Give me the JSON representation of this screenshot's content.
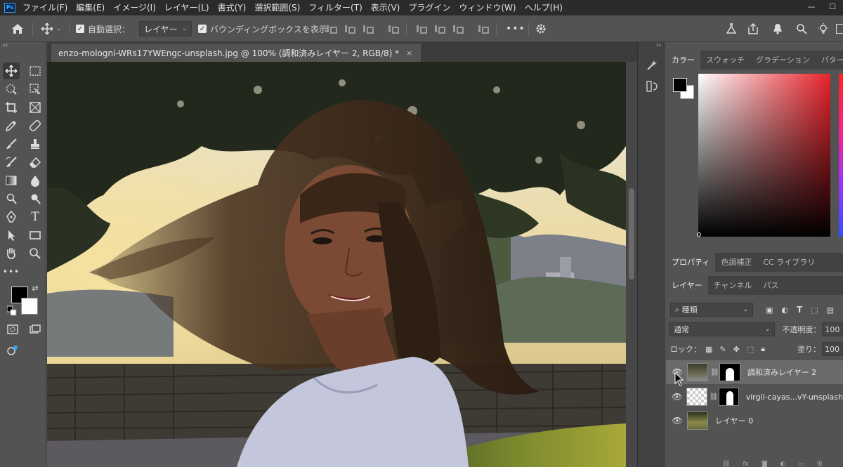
{
  "app": {
    "logo": "Ps"
  },
  "menu": [
    "ファイル(F)",
    "編集(E)",
    "イメージ(I)",
    "レイヤー(L)",
    "書式(Y)",
    "選択範囲(S)",
    "フィルター(T)",
    "表示(V)",
    "プラグイン",
    "ウィンドウ(W)",
    "ヘルプ(H)"
  ],
  "window_controls": {
    "minimize": "—",
    "maximize": "☐"
  },
  "options_bar": {
    "auto_select_label": "自動選択：",
    "auto_select_target": "レイヤー",
    "bounding_box_label": "バウンディングボックスを表示",
    "more": "•••"
  },
  "document": {
    "tab_title": "enzo-mologni-WRs17YWEngc-unsplash.jpg @ 100% (調和済みレイヤー 2, RGB/8) *",
    "close": "×"
  },
  "color_panel": {
    "tabs": [
      "カラー",
      "スウォッチ",
      "グラデーション",
      "パターン"
    ],
    "active_tab": 0,
    "foreground": "#000000",
    "background": "#ffffff"
  },
  "properties_panel": {
    "tabs": [
      "プロパティ",
      "色調補正",
      "CC ライブラリ"
    ],
    "active_tab": 0
  },
  "layers_panel": {
    "tabs": [
      "レイヤー",
      "チャンネル",
      "パス"
    ],
    "active_tab": 0,
    "filter_kind": "種類",
    "blend_mode": "通常",
    "opacity_label": "不透明度：",
    "opacity_value": "100",
    "lock_label": "ロック：",
    "fill_label": "塗り：",
    "fill_value": "100",
    "layers": [
      {
        "name": "調和済みレイヤー 2",
        "visible": true,
        "selected": true,
        "has_mask": true
      },
      {
        "name": "virgil-cayas...vY-unsplash",
        "visible": true,
        "selected": false,
        "has_mask": true
      },
      {
        "name": "レイヤー 0",
        "visible": true,
        "selected": false,
        "has_mask": false
      }
    ]
  },
  "tool_collapse": "‹‹"
}
